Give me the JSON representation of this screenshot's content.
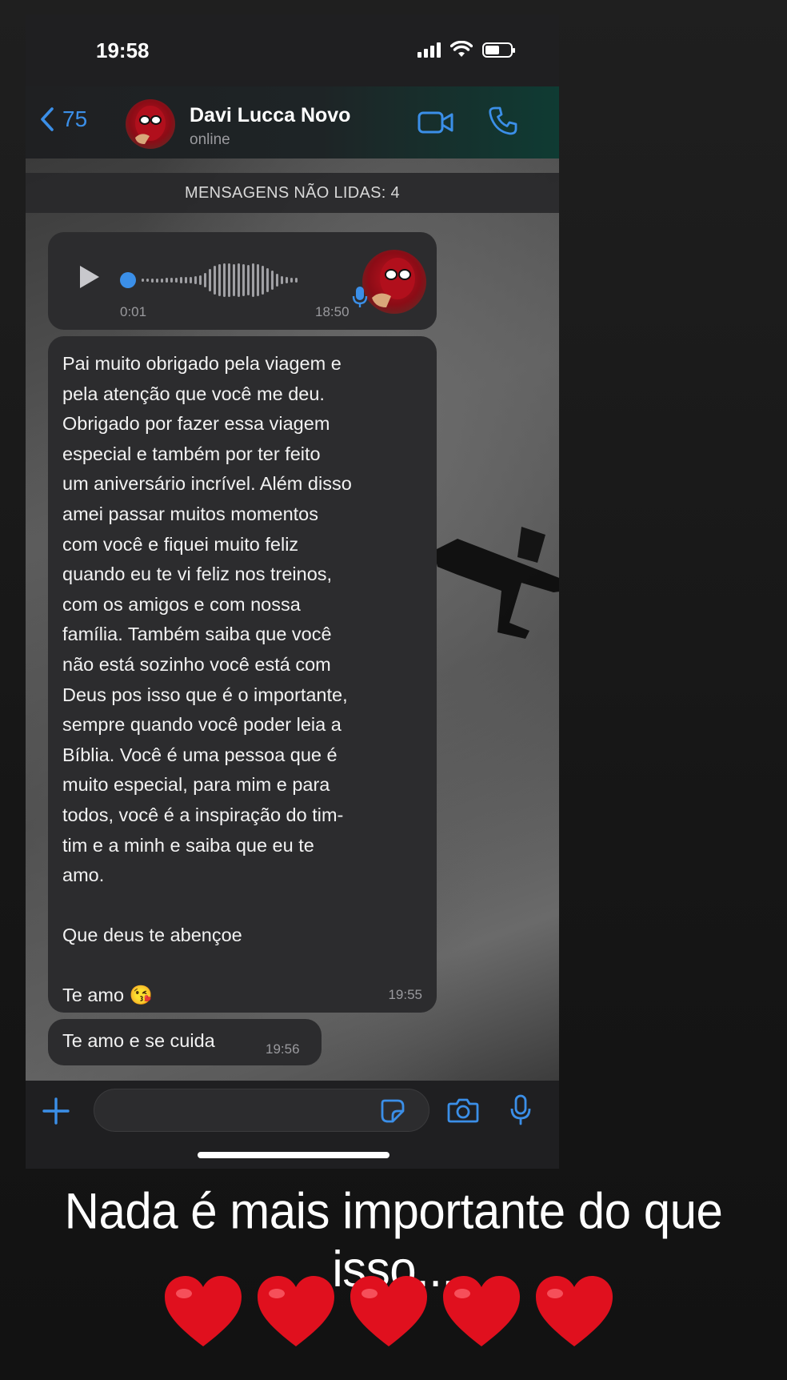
{
  "status_bar": {
    "time": "19:58"
  },
  "header": {
    "back_count": "75",
    "contact_name": "Davi Lucca Novo",
    "contact_status": "online"
  },
  "chat": {
    "unread_banner": "MENSAGENS NÃO LIDAS: 4",
    "voice_message": {
      "elapsed": "0:01",
      "time": "18:50"
    },
    "long_message": {
      "text": "Pai muito obrigado pela viagem e\npela atenção que você me deu.\nObrigado por fazer essa viagem\nespecial e também por ter feito\num aniversário incrível. Além disso\namei passar muitos momentos\ncom você e fiquei muito feliz\nquando eu te vi feliz nos treinos,\ncom os amigos e com nossa\nfamília. Também saiba que você\nnão está sozinho você está com\nDeus pos isso que é o importante,\nsempre quando você poder leia a\nBíblia. Você é uma pessoa que é\nmuito especial, para mim e para\ntodos, você é a inspiração do tim-\ntim e a minh e saiba que eu te\namo.\n\nQue deus te abençoe\n\nTe amo 😘",
      "time": "19:55"
    },
    "short_message": {
      "text": "Te amo e se cuida",
      "time": "19:56"
    }
  },
  "input": {
    "placeholder": ""
  },
  "caption": "Nada é mais importante do que isso...",
  "hearts": [
    "heart-icon",
    "heart-icon",
    "heart-icon",
    "heart-icon",
    "heart-icon"
  ],
  "colors": {
    "accent": "#3b8fe8",
    "bubble": "#2c2c2e",
    "heart": "#e0101e"
  }
}
